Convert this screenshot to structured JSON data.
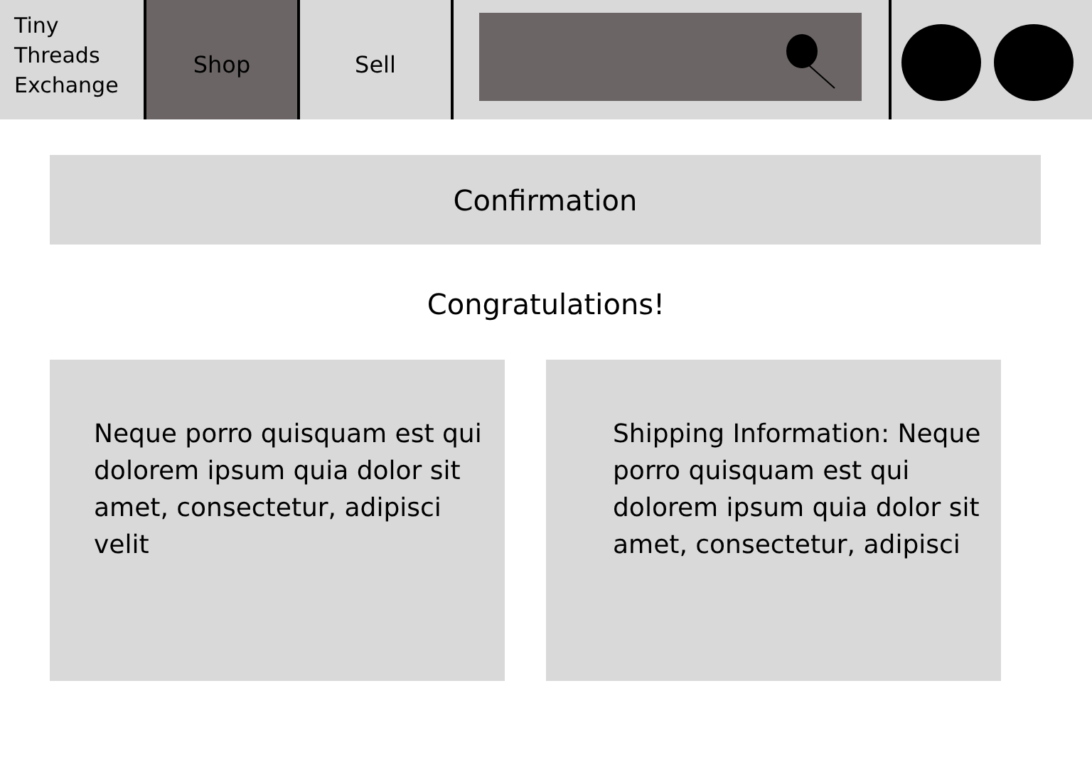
{
  "brand": "Tiny Threads Exchange",
  "tabs": [
    {
      "label": "Shop",
      "selected": true
    },
    {
      "label": "Sell",
      "selected": false
    }
  ],
  "banner": "Confirmation",
  "message": "Congratulations!",
  "cards": [
    "Neque porro quisquam est qui dolorem ipsum quia dolor sit amet, consectetur, adipisci velit",
    "Shipping Information: Neque porro quisquam est qui dolorem ipsum quia dolor sit amet, consectetur, adipisci"
  ]
}
